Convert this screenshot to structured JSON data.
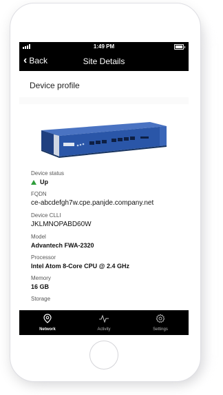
{
  "status_bar": {
    "time": "1:49 PM"
  },
  "nav": {
    "back_label": "Back",
    "title": "Site Details"
  },
  "section": {
    "title": "Device profile"
  },
  "device": {
    "status_label": "Device status",
    "status_value": "Up",
    "status_color": "#2e9d3a",
    "fqdn_label": "FQDN",
    "fqdn_value": "ce-abcdefgh7w.cpe.panjde.company.net",
    "clli_label": "Device CLLI",
    "clli_value": "JKLMNOPABD60W",
    "model_label": "Model",
    "model_value": "Advantech FWA-2320",
    "processor_label": "Processor",
    "processor_value": "Intel Atom 8-Core CPU @ 2.4 GHz",
    "memory_label": "Memory",
    "memory_value": "16 GB",
    "storage_label": "Storage"
  },
  "tabs": [
    {
      "label": "Network",
      "icon": "location-pin-icon",
      "active": true
    },
    {
      "label": "Activity",
      "icon": "pulse-icon",
      "active": false
    },
    {
      "label": "Settings",
      "icon": "gear-icon",
      "active": false
    }
  ],
  "colors": {
    "bar": "#000000",
    "accent_up": "#2e9d3a",
    "device_blue": "#2a56a8"
  }
}
